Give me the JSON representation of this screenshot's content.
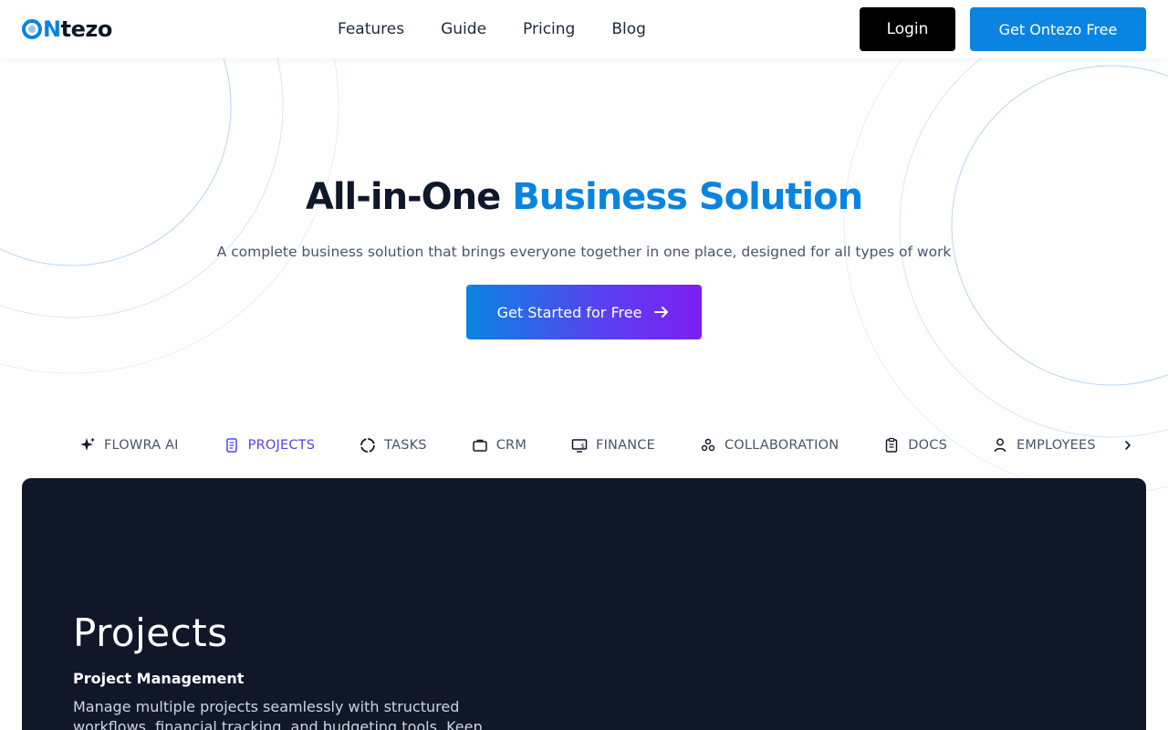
{
  "header": {
    "logo_n": "N",
    "logo_rest": "tezo",
    "nav": [
      "Features",
      "Guide",
      "Pricing",
      "Blog"
    ],
    "login_label": "Login",
    "cta_label": "Get Ontezo Free"
  },
  "hero": {
    "title_part1": "All-in-One ",
    "title_accent": "Business Solution",
    "subtitle": "A complete business solution that brings everyone together in one place, designed for all types of work",
    "cta_label": "Get Started for Free"
  },
  "tabs": [
    {
      "label": "FLOWRA AI",
      "icon": "sparkle-icon",
      "active": false
    },
    {
      "label": "PROJECTS",
      "icon": "document-icon",
      "active": true
    },
    {
      "label": "TASKS",
      "icon": "loader-circle-icon",
      "active": false
    },
    {
      "label": "CRM",
      "icon": "briefcase-icon",
      "active": false
    },
    {
      "label": "FINANCE",
      "icon": "monitor-dollar-icon",
      "active": false
    },
    {
      "label": "COLLABORATION",
      "icon": "team-icon",
      "active": false
    },
    {
      "label": "DOCS",
      "icon": "clipboard-icon",
      "active": false
    },
    {
      "label": "EMPLOYEES",
      "icon": "user-icon",
      "active": false
    }
  ],
  "panel": {
    "title": "Projects",
    "subtitle": "Project Management",
    "description": "Manage multiple projects seamlessly with structured workflows, financial tracking, and budgeting tools. Keep"
  },
  "colors": {
    "brand": "#0a84e1",
    "active_tab": "#4f46e5",
    "panel_bg": "#101729"
  }
}
